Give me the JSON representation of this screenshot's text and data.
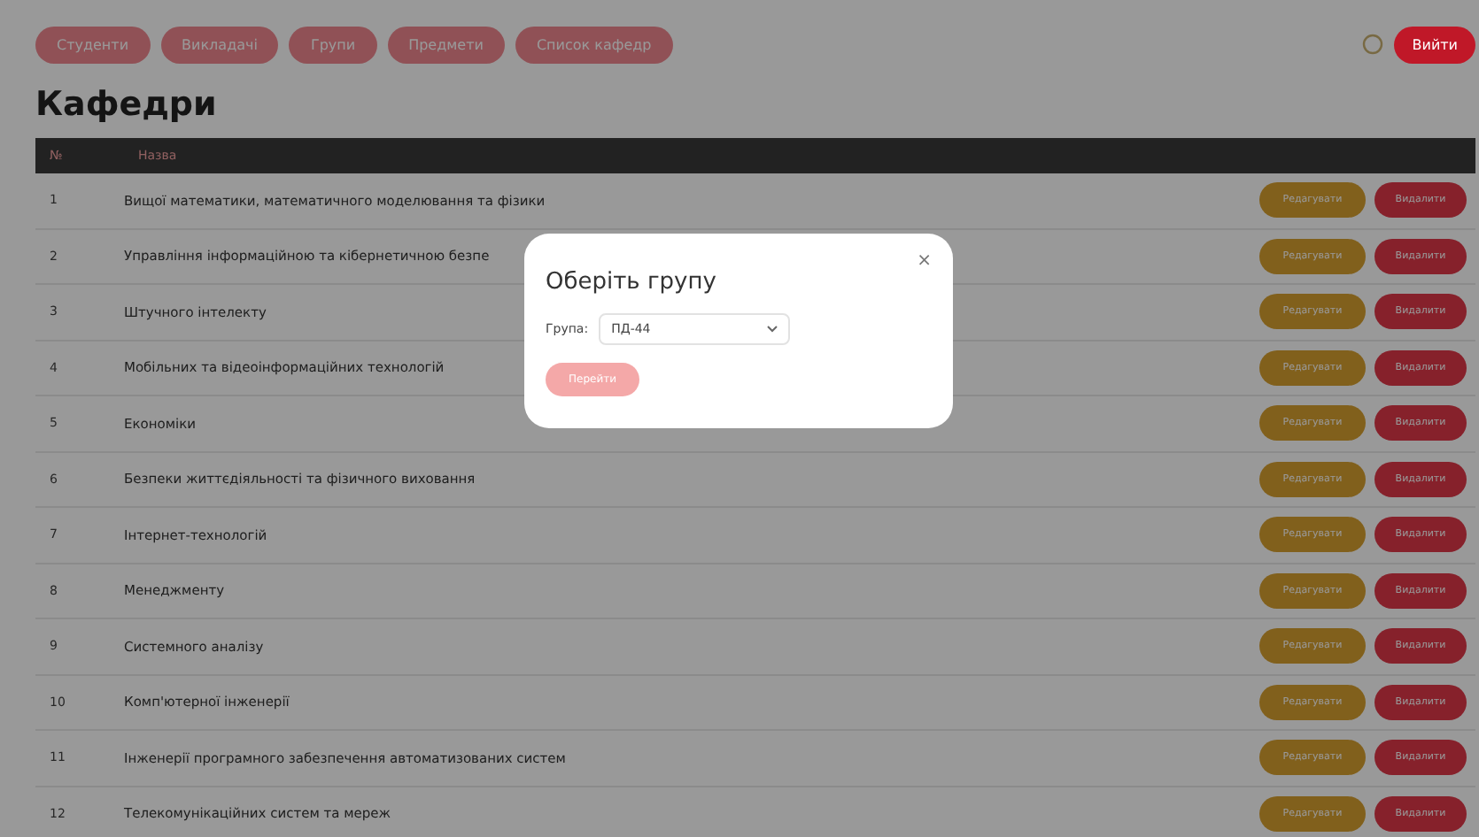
{
  "nav": [
    {
      "label": "Студенти"
    },
    {
      "label": "Викладачі"
    },
    {
      "label": "Групи"
    },
    {
      "label": "Предмети"
    },
    {
      "label": "Список кафедр"
    }
  ],
  "logout": "Вийти",
  "title": "Кафедри",
  "table": {
    "columns": [
      "№",
      "Назва"
    ],
    "rows": [
      {
        "num": "1",
        "name": "Вищої математики, математичного моделювання та фізики",
        "edit": "Редагувати",
        "delete": "Видалити"
      },
      {
        "num": "2",
        "name": "Управління інформаційною та кібернетичною безпе",
        "edit": "Редагувати",
        "delete": "Видалити"
      },
      {
        "num": "3",
        "name": "Штучного інтелекту",
        "edit": "Редагувати",
        "delete": "Видалити"
      },
      {
        "num": "4",
        "name": "Мобільних та відеоінформаційних технологій",
        "edit": "Редагувати",
        "delete": "Видалити"
      },
      {
        "num": "5",
        "name": "Економіки",
        "edit": "Редагувати",
        "delete": "Видалити"
      },
      {
        "num": "6",
        "name": "Безпеки життєдіяльності та фізичного виховання",
        "edit": "Редагувати",
        "delete": "Видалити"
      },
      {
        "num": "7",
        "name": "Інтернет-технологій",
        "edit": "Редагувати",
        "delete": "Видалити"
      },
      {
        "num": "8",
        "name": "Менеджменту",
        "edit": "Редагувати",
        "delete": "Видалити"
      },
      {
        "num": "9",
        "name": "Системного аналізу",
        "edit": "Редагувати",
        "delete": "Видалити"
      },
      {
        "num": "10",
        "name": "Комп'ютерної інженерії",
        "edit": "Редагувати",
        "delete": "Видалити"
      },
      {
        "num": "11",
        "name": "Інженерії програмного забезпечення автоматизованих систем",
        "edit": "Редагувати",
        "delete": "Видалити"
      },
      {
        "num": "12",
        "name": "Телекомунікаційних систем та мереж",
        "edit": "Редагувати",
        "delete": "Видалити"
      }
    ]
  },
  "modal": {
    "title": "Оберіть групу",
    "close": "×",
    "label": "Група:",
    "value": "ПД-44",
    "button": "Перейти",
    "button_disabled": true
  }
}
